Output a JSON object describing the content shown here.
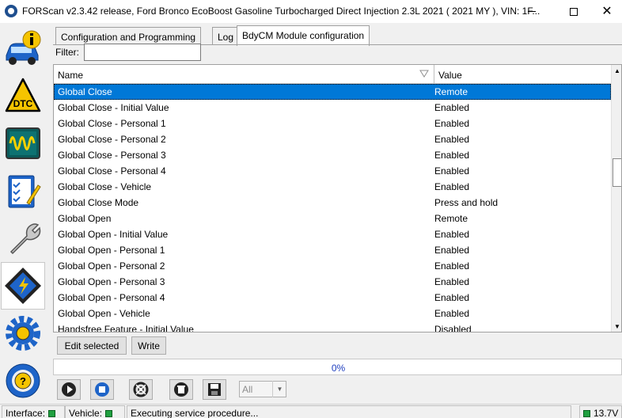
{
  "window": {
    "title": "FORScan v2.3.42 release, Ford Bronco EcoBoost Gasoline Turbocharged Direct Injection 2.3L 2021 ( 2021 MY ), VIN: 1F...",
    "minimize_glyph": "—",
    "maximize_glyph": "☐",
    "close_glyph": "✕"
  },
  "left_toolbar": {
    "items": [
      {
        "name": "vehicle-info-icon"
      },
      {
        "name": "dtc-icon",
        "label": "DTC"
      },
      {
        "name": "oscilloscope-icon"
      },
      {
        "name": "tests-checklist-icon"
      },
      {
        "name": "wrench-icon"
      },
      {
        "name": "configuration-chip-icon",
        "active": true
      },
      {
        "name": "settings-gear-icon"
      },
      {
        "name": "help-steering-icon"
      }
    ],
    "dtc_label": "DTC",
    "help_label": "?"
  },
  "tabs": [
    {
      "label": "Configuration and Programming"
    },
    {
      "label": "Log"
    },
    {
      "label": "BdyCM Module configuration",
      "selected": true
    }
  ],
  "filter": {
    "label": "Filter:",
    "value": "",
    "placeholder": ""
  },
  "grid": {
    "columns": [
      "Name",
      "Value"
    ],
    "rows": [
      {
        "name": "Global Close",
        "value": "Remote",
        "selected": true
      },
      {
        "name": "Global Close - Initial Value",
        "value": "Enabled"
      },
      {
        "name": "Global Close - Personal 1",
        "value": "Enabled"
      },
      {
        "name": "Global Close - Personal 2",
        "value": "Enabled"
      },
      {
        "name": "Global Close - Personal 3",
        "value": "Enabled"
      },
      {
        "name": "Global Close - Personal 4",
        "value": "Enabled"
      },
      {
        "name": "Global Close - Vehicle",
        "value": "Enabled"
      },
      {
        "name": "Global Close Mode",
        "value": "Press and hold"
      },
      {
        "name": "Global Open",
        "value": "Remote"
      },
      {
        "name": "Global Open - Initial Value",
        "value": "Enabled"
      },
      {
        "name": "Global Open - Personal 1",
        "value": "Enabled"
      },
      {
        "name": "Global Open - Personal 2",
        "value": "Enabled"
      },
      {
        "name": "Global Open - Personal 3",
        "value": "Enabled"
      },
      {
        "name": "Global Open - Personal 4",
        "value": "Enabled"
      },
      {
        "name": "Global Open - Vehicle",
        "value": "Enabled"
      },
      {
        "name": "Handsfree Feature - Initial Value",
        "value": "Disabled"
      }
    ],
    "scroll_up_glyph": "▲",
    "scroll_down_glyph": "▼"
  },
  "actions": {
    "edit_selected": "Edit selected",
    "write": "Write"
  },
  "progress": {
    "percent": 0,
    "label": "0%"
  },
  "bottom_toolbar": {
    "buttons": [
      "play-icon",
      "stop-icon",
      "lifebuoy-icon",
      "clear-icon",
      "save-icon"
    ],
    "select_value": "All",
    "select_arrow": "▼"
  },
  "status": {
    "interface_label": "Interface:",
    "vehicle_label": "Vehicle:",
    "message": "Executing service procedure...",
    "voltage": "13.7V",
    "accent": "#0078d7",
    "led_color": "#20a040"
  }
}
